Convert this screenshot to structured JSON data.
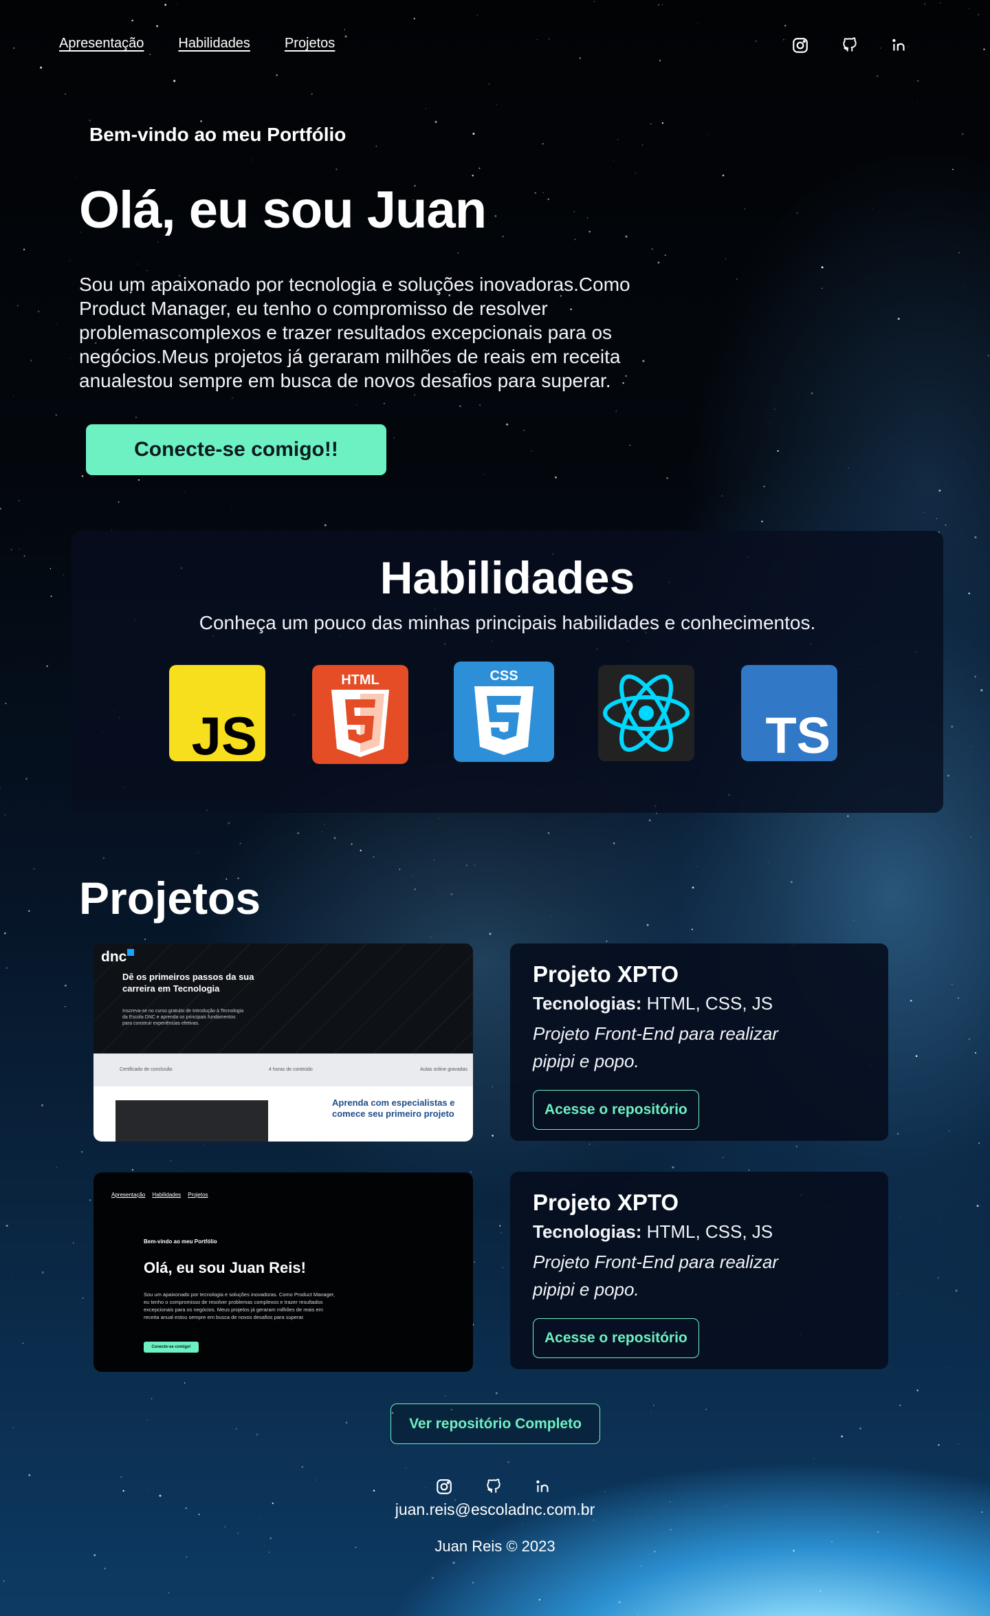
{
  "nav": {
    "links": [
      "Apresentação",
      "Habilidades",
      "Projetos"
    ]
  },
  "social": [
    "instagram-icon",
    "github-icon",
    "linkedin-icon"
  ],
  "hero": {
    "welcome": "Bem-vindo ao meu Portfólio",
    "title": "Olá, eu sou Juan",
    "text": "Sou um apaixonado por tecnologia e soluções inovadoras.Como Product Manager, eu tenho o compromisso de resolver problemascomplexos e trazer resultados excepcionais para os negócios.Meus projetos já geraram milhões de reais em receita anualestou sempre em busca de novos desafios para superar.",
    "cta": "Conecte-se comigo!!"
  },
  "skills": {
    "title": "Habilidades",
    "subtitle": "Conheça um pouco das minhas principais habilidades e conhecimentos.",
    "logos": [
      {
        "name": "javascript-logo",
        "text": "JS",
        "color": "#f7df1e"
      },
      {
        "name": "html5-logo",
        "text": "HTML",
        "color": "#e44d26"
      },
      {
        "name": "css3-logo",
        "text": "CSS",
        "color": "#2d8fd8"
      },
      {
        "name": "react-logo",
        "text": "",
        "color": "#222222"
      },
      {
        "name": "typescript-logo",
        "text": "TS",
        "color": "#3178c6"
      }
    ]
  },
  "projects": {
    "title": "Projetos",
    "cards": [
      {
        "title": "Projeto XPTO",
        "tech_label": "Tecnologias:",
        "tech": "HTML, CSS, JS",
        "desc": "Projeto Front-End para realizar pipipi e popo.",
        "button": "Acesse o repositório"
      },
      {
        "title": "Projeto XPTO",
        "tech_label": "Tecnologias:",
        "tech": "HTML, CSS, JS",
        "desc": "Projeto Front-End para realizar pipipi e popo.",
        "button": "Acesse o repositório"
      }
    ],
    "thumb1": {
      "logo": "dnc",
      "heading": "Dê os primeiros passos da sua carreira em Tecnologia",
      "paragraph": "Inscreva-se no curso gratuito de Introdução à Tecnologia da Escola DNC e aprenda os principais fundamentos para construir experiências efetivas.",
      "bar_items": [
        "Certificado de conclusão",
        "4 horas de conteúdo",
        "Aulas online gravadas"
      ],
      "aprenda": "Aprenda com especialistas e comece seu primeiro projeto"
    },
    "thumb2": {
      "nav": [
        "Apresentação",
        "Habilidades",
        "Projetos"
      ],
      "welcome": "Bem-vindo ao meu Portfólio",
      "title": "Olá, eu sou Juan Reis!",
      "text": "Sou um apaixonado por tecnologia e soluções inovadoras. Como Product Manager, eu tenho o compromisso de resolver problemas complexos e trazer resultados excepcionais para os negócios. Meus projetos já geraram milhões de reais em receita anual estou sempre em busca de novos desafios para superar.",
      "button": "Conecte-se comigo!"
    }
  },
  "footer": {
    "full_repo": "Ver repositório Completo",
    "email": "juan.reis@escoladnc.com.br",
    "copyright": "Juan Reis © 2023"
  },
  "colors": {
    "accent": "#6ef1c2",
    "card_bg": "#070e1e"
  }
}
